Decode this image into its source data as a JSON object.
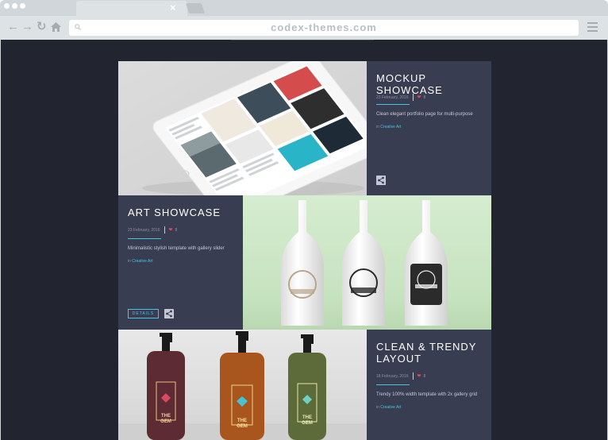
{
  "browser": {
    "url": "codex-themes.com",
    "tab_close": "×"
  },
  "colors": {
    "page_bg": "#22252f",
    "panel_bg": "#393d52",
    "accent": "#49c3e0",
    "heart": "#e84858"
  },
  "portfolio": [
    {
      "title": "MOCKUP SHOWCASE",
      "date": "23 February, 2016",
      "likes": "8",
      "description": "Clean elegant portfolio page for multi-purpose",
      "category_prefix": "in",
      "category": "Creative Art",
      "image": "tablet-mockup-image"
    },
    {
      "title": "ART SHOWCASE",
      "date": "23 February, 2016",
      "likes": "8",
      "description": "Minimalistic stylish template with gallery slider",
      "category_prefix": "in",
      "category": "Creative Art",
      "details_label": "DETAILS",
      "image": "white-bottles-image"
    },
    {
      "title": "CLEAN & TRENDY LAYOUT",
      "date": "18 February, 2016",
      "likes": "8",
      "description": "Trendy 100% width template with 2x gallery grid",
      "category_prefix": "in",
      "category": "Creative Art",
      "image": "pump-bottles-image"
    }
  ],
  "bottle_labels": {
    "line1": "THE",
    "line2": "GEM"
  },
  "icons": [
    "back-arrow-icon",
    "forward-arrow-icon",
    "reload-icon",
    "home-icon",
    "search-icon",
    "menu-icon",
    "heart-icon",
    "share-icon"
  ]
}
